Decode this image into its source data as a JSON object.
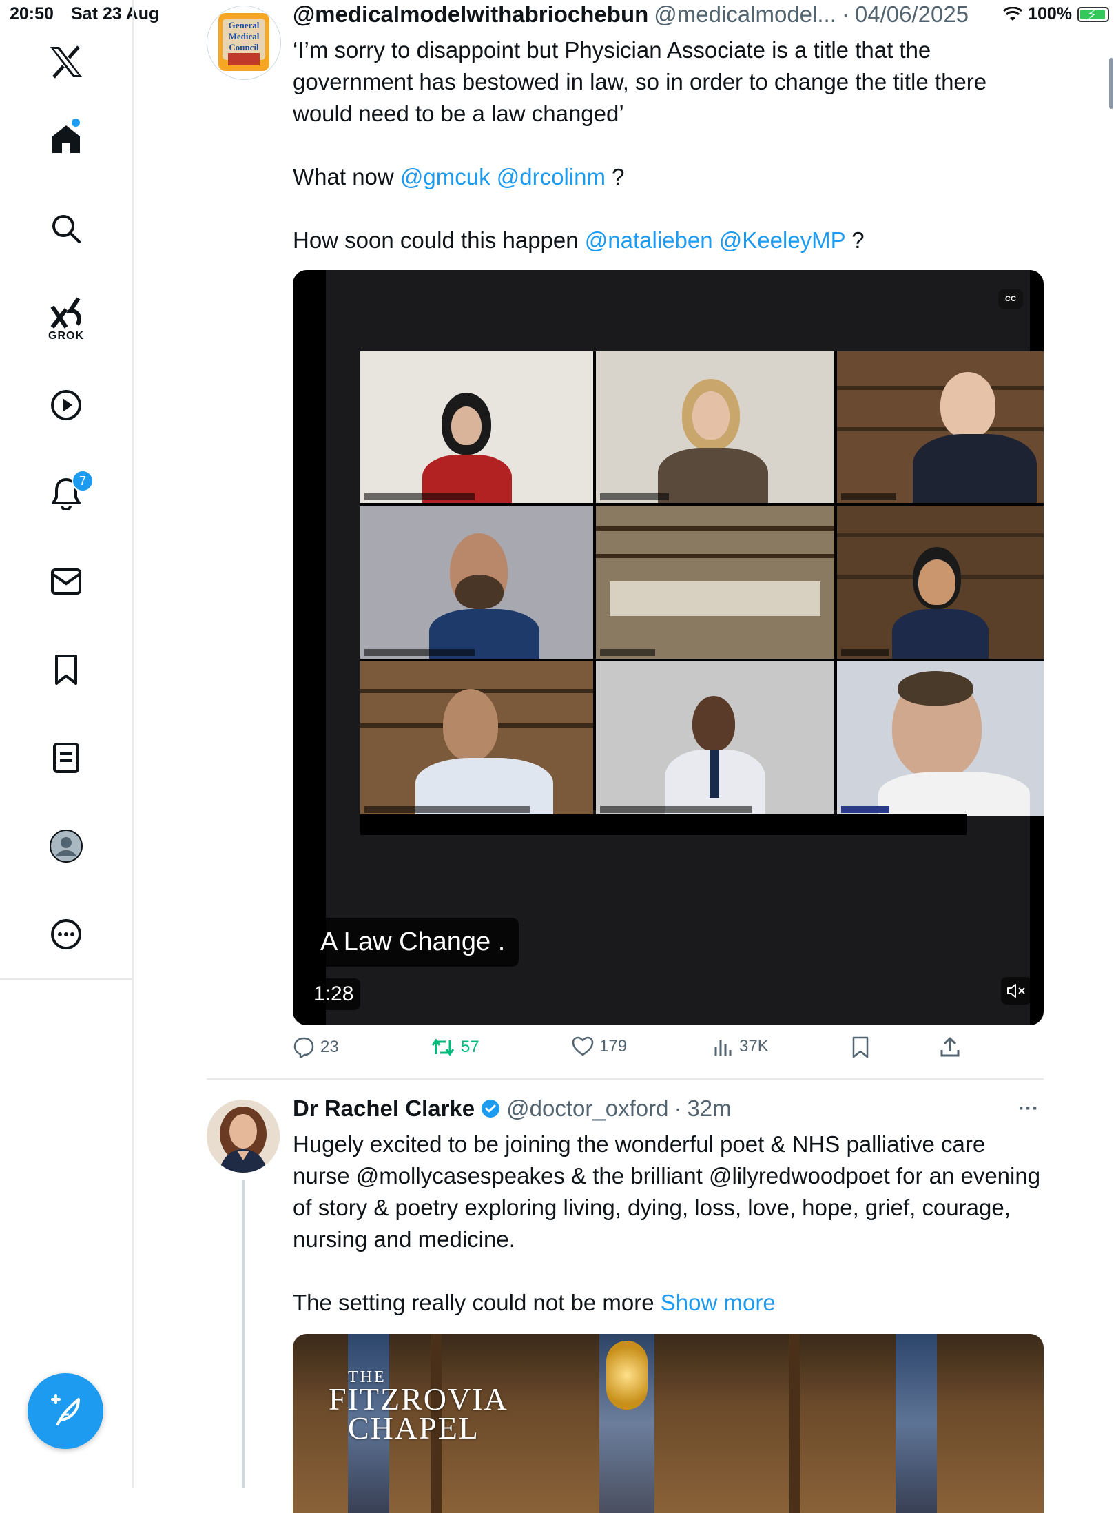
{
  "status_bar": {
    "time": "20:50",
    "date": "Sat 23 Aug",
    "battery": "100%"
  },
  "sidebar": {
    "items": [
      {
        "name": "x-logo"
      },
      {
        "name": "home"
      },
      {
        "name": "search"
      },
      {
        "name": "grok",
        "label": "GROK"
      },
      {
        "name": "video"
      },
      {
        "name": "notifications",
        "badge": "7"
      },
      {
        "name": "messages"
      },
      {
        "name": "bookmarks"
      },
      {
        "name": "lists"
      },
      {
        "name": "profile"
      },
      {
        "name": "more"
      }
    ]
  },
  "tweet1": {
    "avatar_text": [
      "General",
      "Medical",
      "Council"
    ],
    "display_name": "@medicalmodelwithabriochebun",
    "handle": "@medicalmodel...",
    "separator": "·",
    "date": "04/06/2025",
    "text_line1": "‘I’m sorry to disappoint but Physician Associate is a title that the government has bestowed in law, so in order to change the title there would need to be a law changed’",
    "what_now": "What now",
    "mention1": "@gmcuk",
    "mention2": "@drcolinm",
    "q1": "?",
    "how_soon": "How soon could this happen",
    "mention3": "@natalieben",
    "mention4": "@KeeleyMP",
    "q2": "?",
    "video": {
      "cc": "CC",
      "caption": "A Law Change .",
      "duration": "1:28"
    },
    "actions": {
      "replies": "23",
      "reposts": "57",
      "likes": "179",
      "views": "37K"
    }
  },
  "tweet2": {
    "display_name": "Dr Rachel Clarke",
    "handle": "@doctor_oxford",
    "separator": "·",
    "time": "32m",
    "more": "···",
    "text": "Hugely excited to be joining the wonderful poet & NHS palliative care nurse @mollycasespeakes & the brilliant @lilyredwoodpoet for an evening of story & poetry exploring living, dying, loss, love, hope, grief, courage, nursing and medicine.",
    "text2": "The setting really could not be more",
    "show_more": "Show more",
    "image_title_the": "THE",
    "image_title_main1": "FITZROVIA",
    "image_title_main2": "CHAPEL"
  },
  "colors": {
    "accent": "#1d9bf0",
    "repost": "#00ba7c",
    "muted": "#536471"
  }
}
